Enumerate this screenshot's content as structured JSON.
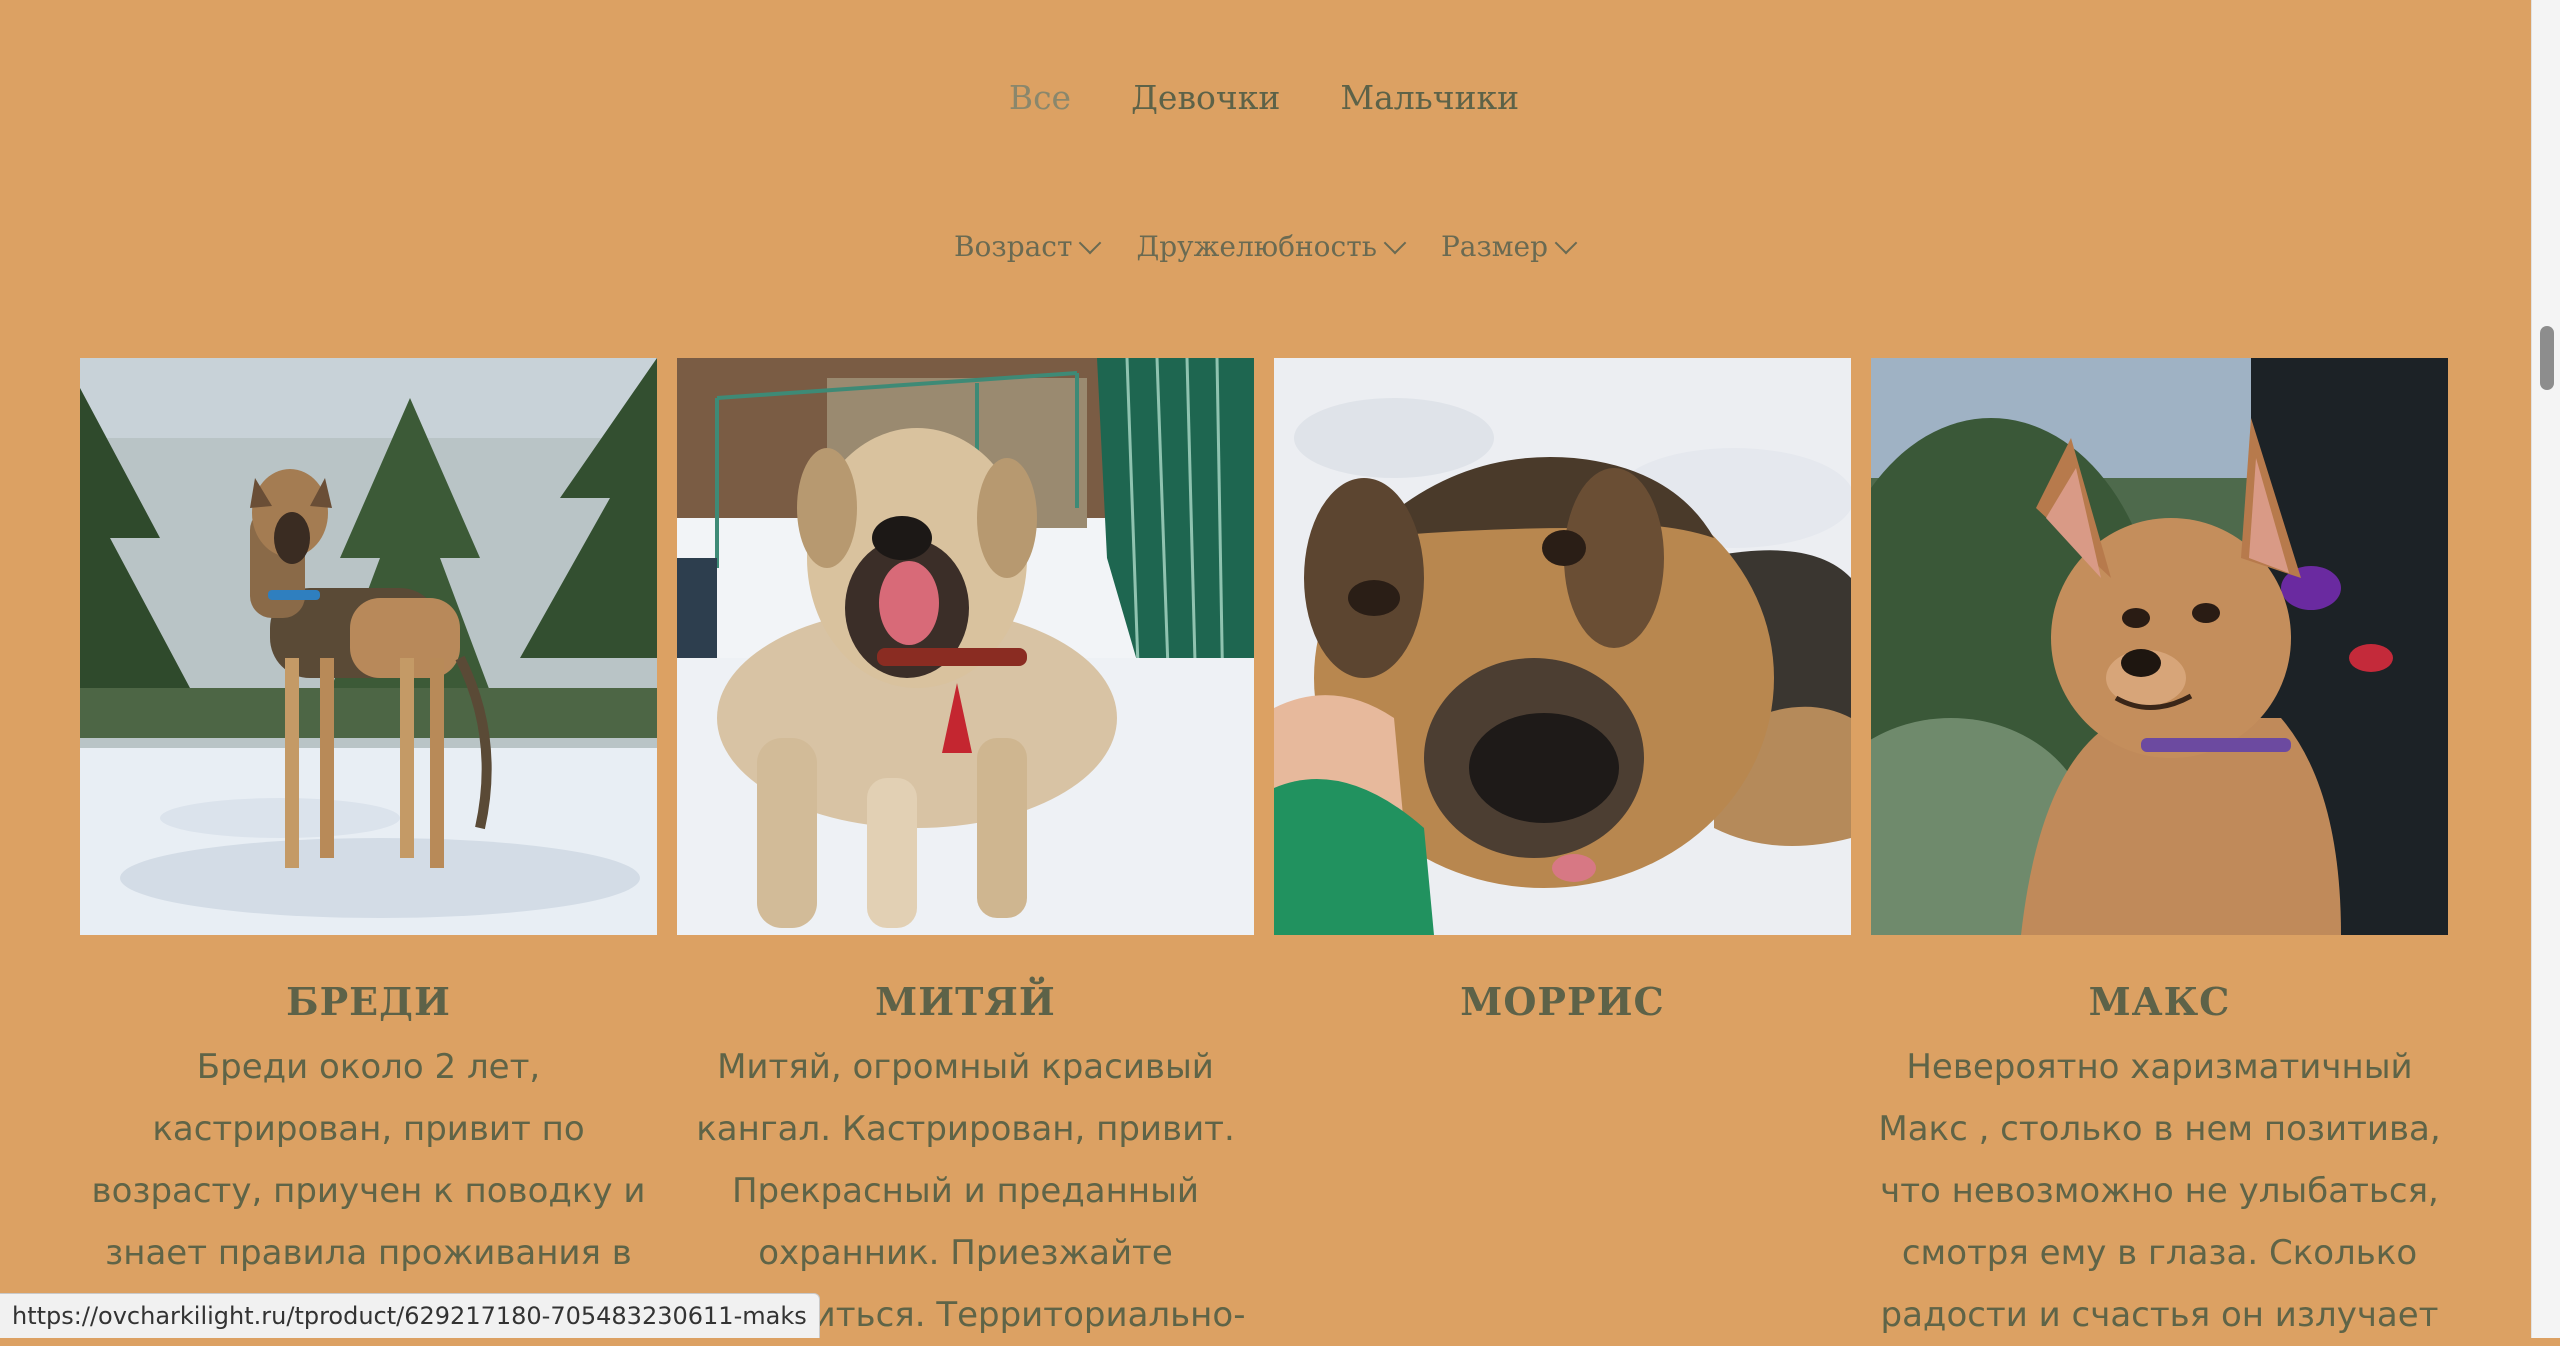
{
  "tabs": [
    {
      "label": "Все"
    },
    {
      "label": "Девочки"
    },
    {
      "label": "Мальчики"
    }
  ],
  "filters": [
    {
      "label": "Возраст",
      "icon": "chevron-down-icon"
    },
    {
      "label": "Дружелюбность",
      "icon": "chevron-down-icon"
    },
    {
      "label": "Размер",
      "icon": "chevron-down-icon"
    }
  ],
  "dogs": [
    {
      "name": "БРЕДИ",
      "description": "Бреди около 2 лет, кастрирован, привит по возрасту, приучен к поводку и знает правила проживания в доме. И очень"
    },
    {
      "name": "МИТЯЙ",
      "description": "Митяй, огромный красивый кангал. Кастрирован, привит. Прекрасный и преданный охранник. Приезжайте знакомиться. Территориально-"
    },
    {
      "name": "МОРРИС",
      "description": ""
    },
    {
      "name": "МАКС",
      "description": "Невероятно харизматичный Макс , столько в нем позитива, что невозможно не улыбаться, смотря ему в глаза. Сколько радости и счастья он излучает"
    }
  ],
  "status_url": "https://ovcharkilight.ru/tproduct/629217180-705483230611-maks",
  "colors": {
    "background": "#dca163",
    "text": "#5d6248",
    "active_tab": "#8a876c"
  }
}
